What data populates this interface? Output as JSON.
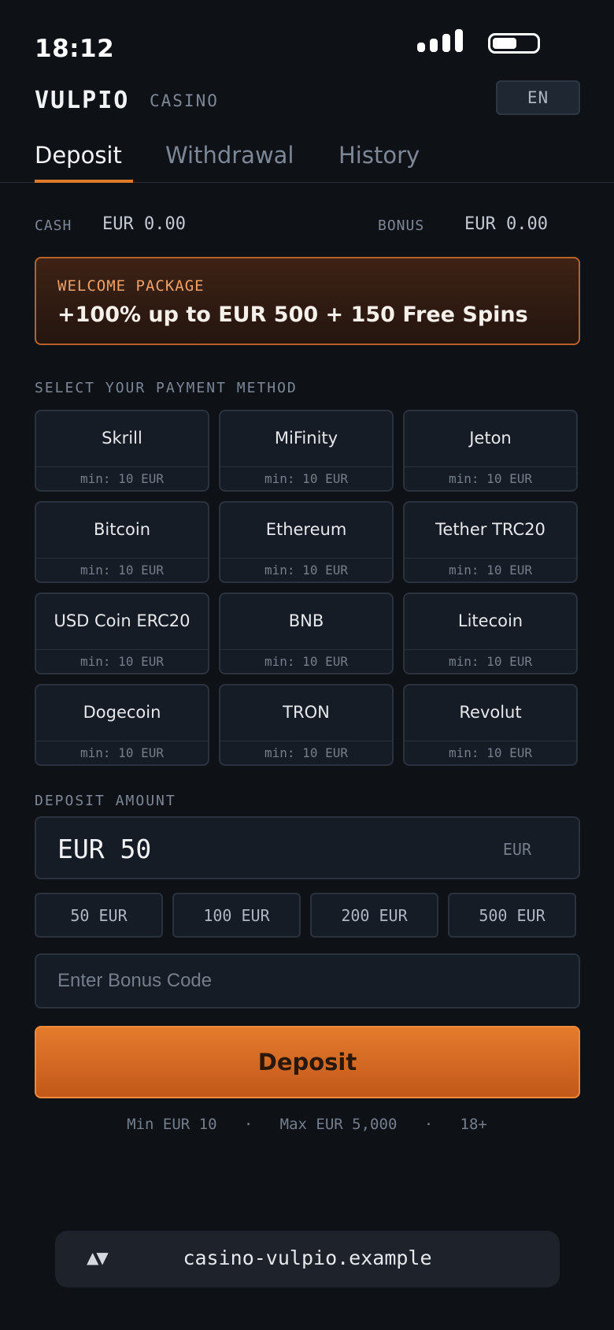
{
  "status_bar": {
    "time": "18:12",
    "battery_level": 0.55
  },
  "header": {
    "brand": "VULPIO",
    "brand_sub": "CASINO",
    "language": "EN"
  },
  "tabs": [
    {
      "label": "Deposit",
      "active": true
    },
    {
      "label": "Withdrawal",
      "active": false
    },
    {
      "label": "History",
      "active": false
    }
  ],
  "balances": {
    "cash_label": "CASH",
    "cash_value": "EUR 0.00",
    "bonus_label": "BONUS",
    "bonus_value": "EUR 0.00"
  },
  "promo": {
    "kicker": "WELCOME PACKAGE",
    "title": "+100% up to EUR 500 + 150 Free Spins"
  },
  "payment": {
    "section_label": "SELECT YOUR PAYMENT METHOD",
    "methods": [
      {
        "name": "Skrill",
        "min": "min: 10 EUR"
      },
      {
        "name": "MiFinity",
        "min": "min: 10 EUR"
      },
      {
        "name": "Jeton",
        "min": "min: 10 EUR"
      },
      {
        "name": "Bitcoin",
        "min": "min: 10 EUR"
      },
      {
        "name": "Ethereum",
        "min": "min: 10 EUR"
      },
      {
        "name": "Tether TRC20",
        "min": "min: 10 EUR"
      },
      {
        "name": "USD Coin ERC20",
        "min": "min: 10 EUR"
      },
      {
        "name": "BNB",
        "min": "min: 10 EUR"
      },
      {
        "name": "Litecoin",
        "min": "min: 10 EUR"
      },
      {
        "name": "Dogecoin",
        "min": "min: 10 EUR"
      },
      {
        "name": "TRON",
        "min": "min: 10 EUR"
      },
      {
        "name": "Revolut",
        "min": "min: 10 EUR"
      }
    ]
  },
  "amount": {
    "section_label": "DEPOSIT AMOUNT",
    "value": "EUR 50",
    "currency": "EUR",
    "quick": [
      "50 EUR",
      "100 EUR",
      "200 EUR",
      "500 EUR"
    ]
  },
  "bonus_code": {
    "placeholder": "Enter Bonus Code",
    "value": ""
  },
  "deposit_button": "Deposit",
  "limits": {
    "min": "Min EUR 10",
    "max": "Max EUR 5,000",
    "age": "18+",
    "separator": "·"
  },
  "url_bar": {
    "icon": "▲▼",
    "url": "casino-vulpio.example"
  }
}
